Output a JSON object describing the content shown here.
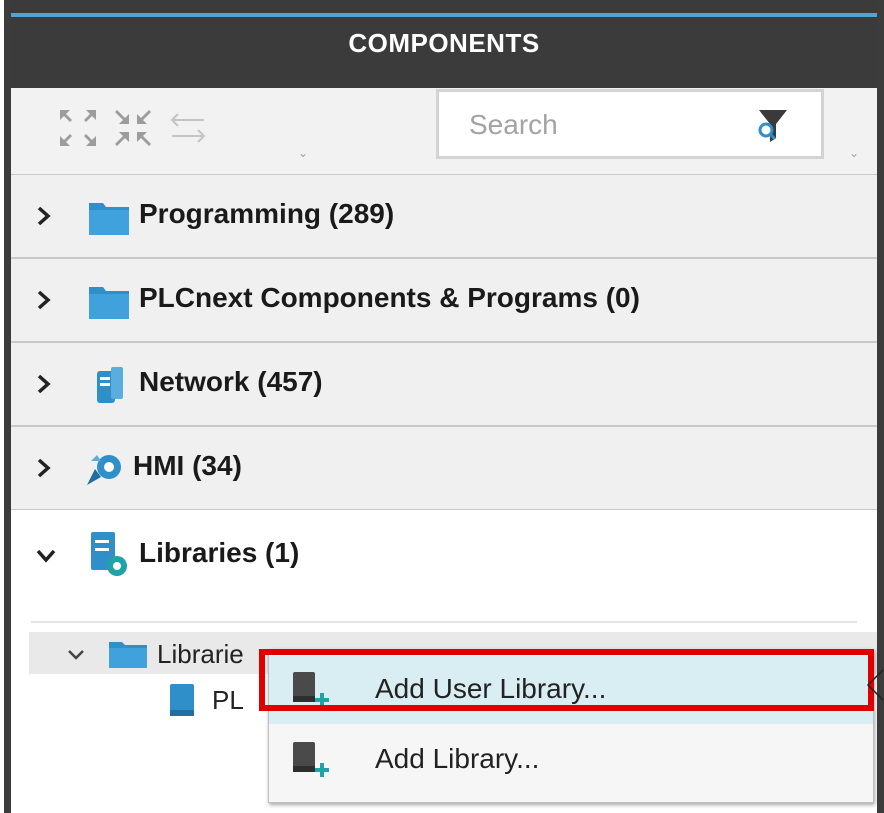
{
  "panel": {
    "title": "COMPONENTS"
  },
  "toolbar": {
    "expand_all_icon": "expand-all-icon",
    "collapse_all_icon": "collapse-all-icon",
    "swap_icon": "swap-arrows-icon",
    "search": {
      "placeholder": "Search",
      "value": ""
    },
    "filter_icon": "filter-search-icon"
  },
  "categories": [
    {
      "label": "Programming (289)",
      "icon": "folder-icon",
      "expanded": false
    },
    {
      "label": "PLCnext Components & Programs (0)",
      "icon": "folder-icon",
      "expanded": false
    },
    {
      "label": "Network (457)",
      "icon": "network-device-icon",
      "expanded": false
    },
    {
      "label": "HMI (34)",
      "icon": "hmi-icon",
      "expanded": false
    }
  ],
  "libraries": {
    "label": "Libraries (1)",
    "icon": "library-gear-icon",
    "expanded": true,
    "sub_folder": {
      "label": "Librarie",
      "icon": "folder-icon",
      "expanded": true
    },
    "sub_item": {
      "label": "PL",
      "icon": "book-icon"
    }
  },
  "context_menu": {
    "items": [
      {
        "label": "Add User Library...",
        "icon": "add-library-icon",
        "highlighted": true
      },
      {
        "label": "Add Library...",
        "icon": "add-library-icon",
        "highlighted": false
      }
    ]
  },
  "colors": {
    "header_bg": "#3b3b3b",
    "accent": "#4ea6d6",
    "highlight": "#d9eef2",
    "annotation_red": "#e00000",
    "icon_blue": "#2f8fc8",
    "icon_teal": "#1fa3a8"
  }
}
